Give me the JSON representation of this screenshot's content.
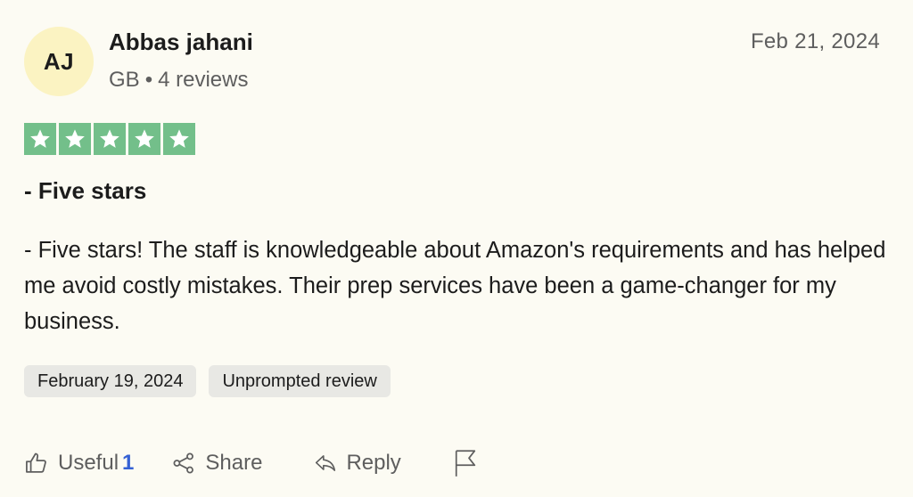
{
  "reviewer": {
    "initials": "AJ",
    "name": "Abbas jahani",
    "country": "GB",
    "separator": "•",
    "review_count": "4 reviews"
  },
  "review": {
    "date": "Feb 21, 2024",
    "rating": 5,
    "rating_max": 5,
    "title": "- Five stars",
    "body": "- Five stars! The staff is knowledgeable about Amazon's requirements and has helped me avoid costly mistakes. Their prep services have been a game-changer for my business.",
    "tags": [
      "February 19, 2024",
      "Unprompted review"
    ]
  },
  "actions": {
    "useful_label": "Useful",
    "useful_count": "1",
    "share_label": "Share",
    "reply_label": "Reply"
  },
  "icons": {
    "star": "star-icon",
    "useful": "thumbs-up-icon",
    "share": "share-icon",
    "reply": "reply-arrow-icon",
    "flag": "flag-icon"
  },
  "colors": {
    "background": "#fcfbf3",
    "avatar_bg": "#fbf3c2",
    "star_bg": "#73bf8a",
    "tag_bg": "#e8e8e4",
    "useful_count": "#3561d4"
  }
}
